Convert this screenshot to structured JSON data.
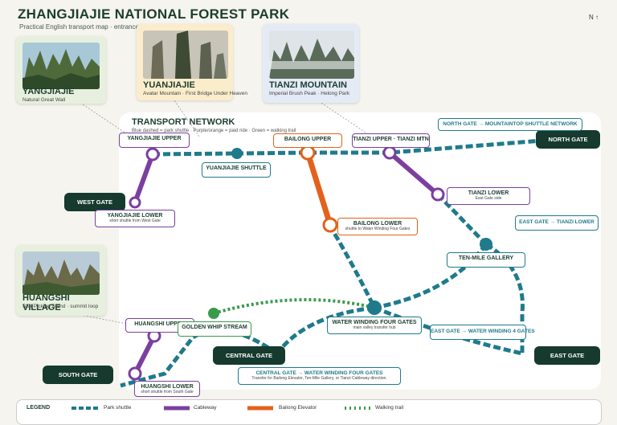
{
  "header": {
    "title": "ZHANGJIAJIE NATIONAL FOREST PARK",
    "subtitle": "Practical English transport map · entrances",
    "north": "N ↑"
  },
  "network": {
    "title": "TRANSPORT NETWORK",
    "note": "Blue dashed = park shuttle · Purple/orange = paid ride · Green = walking trail"
  },
  "cards": [
    {
      "name": "YANGJIAJIE",
      "desc": "Natural Great Wall",
      "bg": "#e7f0de"
    },
    {
      "name": "YUANJIAJIE",
      "desc": "Avatar Mountain · First Bridge Under Heaven",
      "bg": "#fbedcb"
    },
    {
      "name": "TIANZI MOUNTAIN",
      "desc": "Imperial Brush Peak · Helong Park",
      "bg": "#e5ebf6"
    },
    {
      "name": "HUANGSHI VILLAGE",
      "desc": "Star Picking Stand · summit loop",
      "bg": "#e7f0de"
    }
  ],
  "gates": {
    "north": "NORTH GATE",
    "west": "WEST GATE",
    "central": "CENTRAL GATE",
    "south": "SOUTH GATE",
    "east": "EAST GATE"
  },
  "stations": {
    "yangjiajie_upper": "YANGJIAJIE UPPER",
    "yuanjiajie_shuttle": "YUANJIAJIE SHUTTLE",
    "bailong_upper": "BAILONG UPPER",
    "tianzi_upper": "TIANZI UPPER · TIANZI MTN",
    "yangjiajie_lower": {
      "name": "YANGJIAJIE LOWER",
      "desc": "short shuttle from West Gate"
    },
    "tianzi_lower": {
      "name": "TIANZI LOWER",
      "desc": "East Gate side"
    },
    "bailong_lower": {
      "name": "BAILONG LOWER",
      "desc": "shuttle to Water Winding Four Gates"
    },
    "ten_mile": "TEN-MILE GALLERY",
    "huangshi_upper": "HUANGSHI UPPER",
    "golden_whip": "GOLDEN WHIP STREAM",
    "water_winding": {
      "name": "WATER WINDING FOUR GATES",
      "desc": "main valley transfer hub"
    },
    "huangshi_lower": {
      "name": "HUANGSHI LOWER",
      "desc": "short shuttle from South Gate"
    }
  },
  "routes": {
    "north": {
      "name": "NORTH GATE → MOUNTAINTOP SHUTTLE NETWORK"
    },
    "east_tianzi": {
      "name": "EAST GATE → TIANZI LOWER"
    },
    "east_wwfg": {
      "name": "EAST GATE → WATER WINDING 4 GATES"
    },
    "central": {
      "name": "CENTRAL GATE → WATER WINDING FOUR GATES",
      "desc": "Transfer for Bailong Elevator, Ten-Mile Gallery, or Tianzi Cableway direction."
    }
  },
  "legend": {
    "title": "LEGEND",
    "shuttle": "Park shuttle",
    "cableway": "Cableway",
    "elevator": "Bailong Elevator",
    "trail": "Walking trail"
  },
  "colors": {
    "shuttle": "#1f7a8c",
    "cableway": "#7b3fa0",
    "elevator": "#e2621b",
    "trail": "#3a9a4c",
    "gate": "#163a2e"
  }
}
